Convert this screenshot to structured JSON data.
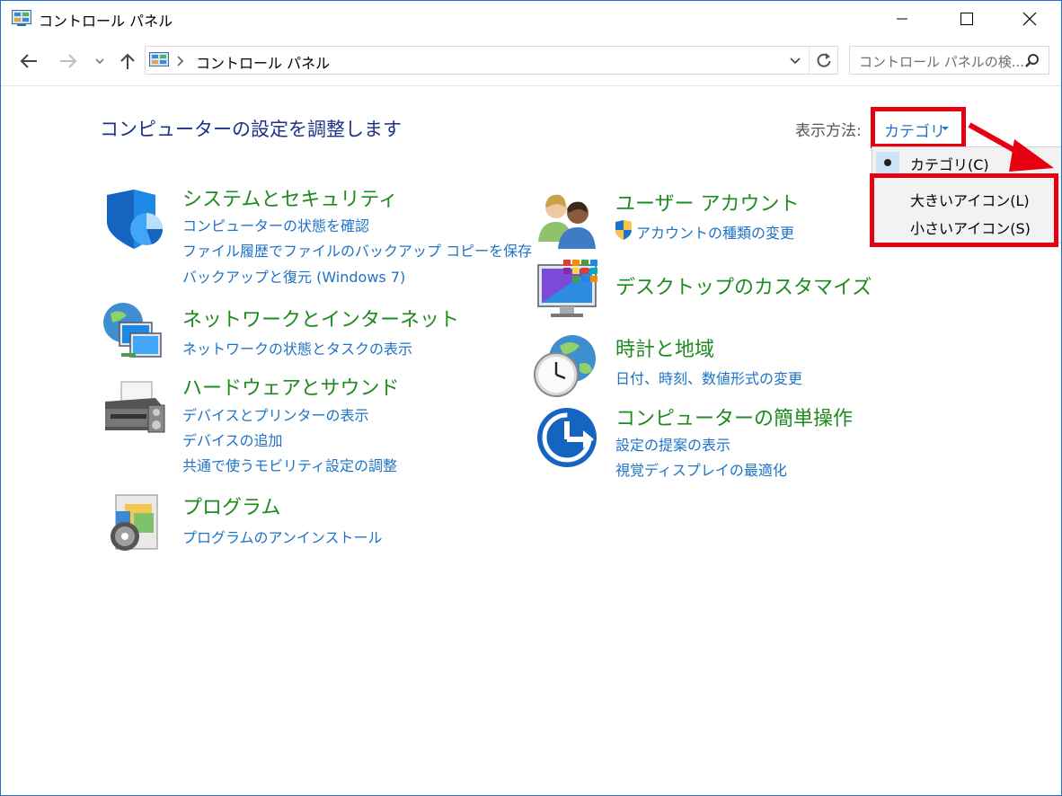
{
  "window": {
    "title": "コントロール パネル"
  },
  "address": {
    "path": "コントロール パネル"
  },
  "search": {
    "placeholder": "コントロール パネルの検..."
  },
  "page": {
    "title": "コンピューターの設定を調整します"
  },
  "view_by": {
    "label": "表示方法:",
    "value": "カテゴリ",
    "options": [
      "カテゴリ(C)",
      "大きいアイコン(L)",
      "小さいアイコン(S)"
    ],
    "selected_index": 0
  },
  "categories": {
    "system": {
      "title": "システムとセキュリティ",
      "links": [
        "コンピューターの状態を確認",
        "ファイル履歴でファイルのバックアップ コピーを保存",
        "バックアップと復元 (Windows 7)"
      ],
      "icon": "shield-icon"
    },
    "network": {
      "title": "ネットワークとインターネット",
      "links": [
        "ネットワークの状態とタスクの表示"
      ],
      "icon": "network-globe-icon"
    },
    "hardware": {
      "title": "ハードウェアとサウンド",
      "links": [
        "デバイスとプリンターの表示",
        "デバイスの追加",
        "共通で使うモビリティ設定の調整"
      ],
      "icon": "printer-icon"
    },
    "programs": {
      "title": "プログラム",
      "links": [
        "プログラムのアンインストール"
      ],
      "icon": "programs-disc-icon"
    },
    "users": {
      "title": "ユーザー アカウント",
      "links": [
        "アカウントの種類の変更"
      ],
      "icon": "users-icon"
    },
    "desktop": {
      "title": "デスクトップのカスタマイズ",
      "links": [],
      "icon": "monitor-icon"
    },
    "clock": {
      "title": "時計と地域",
      "links": [
        "日付、時刻、数値形式の変更"
      ],
      "icon": "clock-globe-icon"
    },
    "ease": {
      "title": "コンピューターの簡単操作",
      "links": [
        "設定の提案の表示",
        "視覚ディスプレイの最適化"
      ],
      "icon": "ease-of-access-icon"
    }
  },
  "colors": {
    "accent": "#1e73c6",
    "category_title": "#1e8a20",
    "highlight": "#e50012",
    "page_title": "#1e3287"
  }
}
